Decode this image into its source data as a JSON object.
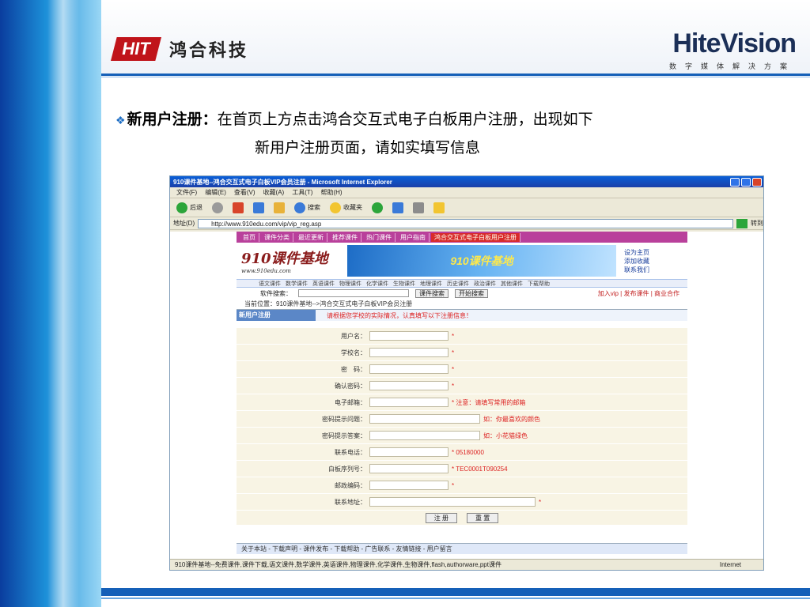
{
  "header": {
    "left_logo_mark": "HIT",
    "left_logo_text": "鸿合科技",
    "right_logo_text": "HiteVision",
    "right_logo_sub": "数字媒体解决方案"
  },
  "content": {
    "bullet": "❖",
    "lead": "新用户注册：",
    "line1": "在首页上方点击鸿合交互式电子白板用户注册，出现如下",
    "line2": "新用户注册页面，请如实填写信息"
  },
  "screenshot": {
    "window_title": "910课件基地--鸿合交互式电子白板VIP会员注册 - Microsoft Internet Explorer",
    "menu": [
      "文件(F)",
      "编辑(E)",
      "查看(V)",
      "收藏(A)",
      "工具(T)",
      "帮助(H)"
    ],
    "toolbar": {
      "back": "后退",
      "search": "搜索",
      "favorites": "收藏夹"
    },
    "address_label": "地址(D)",
    "address_url": "http://www.910edu.com/vip/vip_reg.asp",
    "go_label": "转到",
    "site": {
      "nav": [
        "首页",
        "课件分类",
        "最近更新",
        "推荐课件",
        "热门课件",
        "用户指南"
      ],
      "nav_highlight": "鸿合交互式电子白板用户注册",
      "logo_main": "910课件基地",
      "logo_url": "www.910edu.com",
      "banner_text": "910课件基地",
      "side_links": [
        "设为主页",
        "添加收藏",
        "联系我们"
      ],
      "subnav": [
        "语文课件",
        "数学课件",
        "英语课件",
        "物理课件",
        "化学课件",
        "生物课件",
        "地理课件",
        "历史课件",
        "政治课件",
        "其他课件",
        "下载帮助"
      ],
      "search_label": "软件搜索：",
      "search_type": "课件搜索",
      "search_button": "开始搜索",
      "search_right": "加入vip | 发布课件 | 商业合作",
      "crumb": "当前位置：910课件基地-->鸿合交互式电子白板VIP会员注册",
      "form_title": "新用户注册",
      "form_notice": "请根据您学校的实际情况，认真填写以下注册信息！",
      "fields": [
        {
          "label": "用户名：",
          "note": "*"
        },
        {
          "label": "学校名：",
          "note": "*"
        },
        {
          "label": "密　码：",
          "note": "*"
        },
        {
          "label": "确认密码：",
          "note": "*"
        },
        {
          "label": "电子邮箱：",
          "note": "* 注意：请填写常用的邮箱"
        },
        {
          "label": "密码提示问题：",
          "note": "如：你最喜欢的颜色"
        },
        {
          "label": "密码提示答案：",
          "note": "如：小花猫绿色"
        },
        {
          "label": "联系电话：",
          "note": "* 05180000"
        },
        {
          "label": "白板序列号：",
          "note": "* TEC0001T090254"
        },
        {
          "label": "邮政编码：",
          "note": "*"
        },
        {
          "label": "联系地址：",
          "note": "*"
        }
      ],
      "submit": "注 册",
      "reset": "重 置",
      "footer": "关于本站 - 下载声明 - 课件发布 - 下载帮助 - 广告联系 - 友情链接 - 用户留言"
    },
    "status_text": "910课件基地--免费课件,课件下载,语文课件,数学课件,英语课件,物理课件,化学课件,生物课件,flash,authorware,ppt课件",
    "status_zone": "Internet"
  },
  "colors": {
    "accent": "#1560b8",
    "nav": "#b9409b",
    "alert": "#d22222"
  }
}
